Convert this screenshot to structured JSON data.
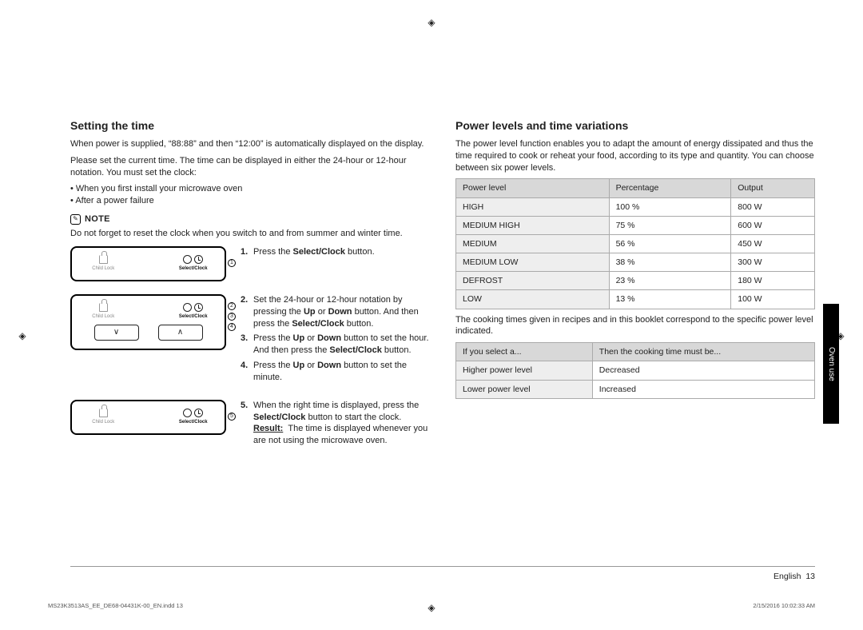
{
  "crop_marks": true,
  "side_tab": "Oven use",
  "footer": {
    "lang": "English",
    "page": "13"
  },
  "print_meta": {
    "file": "MS23K3513AS_EE_DE68-04431K-00_EN.indd   13",
    "stamp": "2/15/2016   10:02:33 AM"
  },
  "left": {
    "heading": "Setting the time",
    "p1": "When power is supplied, “88:88” and then “12:00” is automatically displayed on the display.",
    "p2": "Please set the current time. The time can be displayed in either the 24-hour or 12-hour notation. You must set the clock:",
    "bul1": "When you first install your microwave oven",
    "bul2": "After a power failure",
    "note_label": "NOTE",
    "note_text": "Do not forget to reset the clock when you switch to and from summer and winter time.",
    "panel_labels": {
      "child_lock": "Child Lock",
      "select_clock": "Select/Clock"
    },
    "step1": {
      "pre": "Press the ",
      "b1": "Select/Clock",
      "post": " button."
    },
    "step2": {
      "pre": "Set the 24-hour or 12-hour notation by pressing the ",
      "b1": "Up",
      "mid1": " or ",
      "b2": "Down",
      "mid2": " button. And then press the ",
      "b3": "Select/Clock",
      "post": " button."
    },
    "step3": {
      "pre": "Press the ",
      "b1": "Up",
      "mid1": " or ",
      "b2": "Down",
      "mid2": " button to set the hour. And then press the ",
      "b3": "Select/Clock",
      "post": " button."
    },
    "step4": {
      "pre": "Press the ",
      "b1": "Up",
      "mid1": " or ",
      "b2": "Down",
      "post": " button to set the minute."
    },
    "step5": {
      "pre": "When the right time is displayed, press the ",
      "b1": "Select/Clock",
      "mid": " button to start the clock.",
      "res_lbl": "Result:",
      "res_txt": "The time is displayed whenever you are not using the microwave oven."
    },
    "callouts": [
      "1",
      "2",
      "3",
      "4",
      "5"
    ]
  },
  "right": {
    "heading": "Power levels and time variations",
    "p1": "The power level function enables you to adapt the amount of energy dissipated and thus the time required to cook or reheat your food, according to its type and quantity. You can choose between six power levels.",
    "tbl1": {
      "head": [
        "Power level",
        "Percentage",
        "Output"
      ],
      "rows": [
        [
          "HIGH",
          "100 %",
          "800 W"
        ],
        [
          "MEDIUM HIGH",
          "75 %",
          "600 W"
        ],
        [
          "MEDIUM",
          "56 %",
          "450 W"
        ],
        [
          "MEDIUM LOW",
          "38 %",
          "300 W"
        ],
        [
          "DEFROST",
          "23 %",
          "180 W"
        ],
        [
          "LOW",
          "13 %",
          "100 W"
        ]
      ]
    },
    "p2": "The cooking times given in recipes and in this booklet correspond to the specific power level indicated.",
    "tbl2": {
      "head": [
        "If you select a...",
        "Then the cooking time must be..."
      ],
      "rows": [
        [
          "Higher power level",
          "Decreased"
        ],
        [
          "Lower power level",
          "Increased"
        ]
      ]
    }
  }
}
